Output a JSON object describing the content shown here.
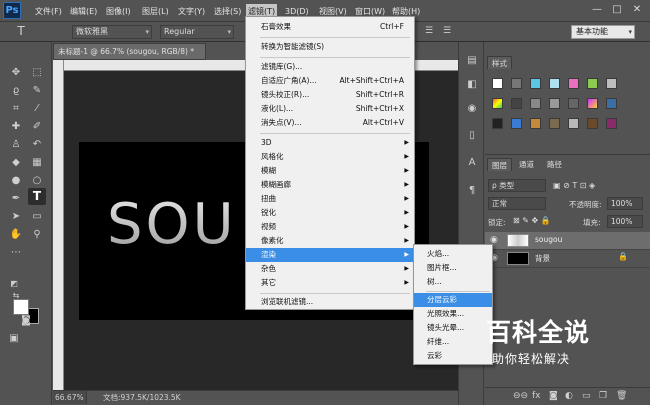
{
  "app": {
    "logo": "Ps"
  },
  "menubar": [
    {
      "label": "文件(F)"
    },
    {
      "label": "编辑(E)"
    },
    {
      "label": "图像(I)"
    },
    {
      "label": "图层(L)"
    },
    {
      "label": "文字(Y)"
    },
    {
      "label": "选择(S)"
    },
    {
      "label": "滤镜(T)"
    },
    {
      "label": "3D(D)"
    },
    {
      "label": "视图(V)"
    },
    {
      "label": "窗口(W)"
    },
    {
      "label": "帮助(H)"
    }
  ],
  "window_controls": {
    "minimize": "—",
    "maximize": "□",
    "close": "✕"
  },
  "options": {
    "tool_glyph": "T",
    "font_family": "微软雅黑",
    "font_style": "Regular",
    "preset": "基本功能"
  },
  "document": {
    "tab_title": "未标题-1 @ 66.7% (sougou, RGB/8) *",
    "tab_close": "×",
    "canvas_text": "SOU",
    "zoom": "66.67%",
    "info": "文档:937.5K/1023.5K"
  },
  "filter_menu": {
    "last_filter": {
      "label": "石膏效果",
      "shortcut": "Ctrl+F"
    },
    "convert_smart": "转换为智能滤镜(S)",
    "gallery": {
      "label": "滤镜库(G)...",
      "shortcut": ""
    },
    "adaptive": {
      "label": "自适应广角(A)...",
      "shortcut": "Alt+Shift+Ctrl+A"
    },
    "lens": {
      "label": "镜头校正(R)...",
      "shortcut": "Shift+Ctrl+R"
    },
    "liquify": {
      "label": "液化(L)...",
      "shortcut": "Shift+Ctrl+X"
    },
    "vanishing": {
      "label": "消失点(V)...",
      "shortcut": "Alt+Ctrl+V"
    },
    "categories": [
      "3D",
      "风格化",
      "模糊",
      "模糊画廊",
      "扭曲",
      "锐化",
      "视频",
      "像素化",
      "渲染",
      "杂色",
      "其它"
    ],
    "browse": "浏览联机滤镜...",
    "arrow": "▶"
  },
  "render_menu": {
    "items": [
      "火焰...",
      "图片框...",
      "树...",
      "分层云彩",
      "光照效果...",
      "镜头光晕...",
      "纤维...",
      "云彩"
    ]
  },
  "styles_panel": {
    "tab": "样式"
  },
  "layers_panel": {
    "tabs": [
      "图层",
      "通道",
      "路径"
    ],
    "filter_kind": "ρ 类型",
    "blend_mode": "正常",
    "opacity_label": "不透明度:",
    "opacity": "100%",
    "lock_label": "锁定:",
    "fill_label": "填充:",
    "fill": "100%",
    "layers": [
      {
        "name": "sougou",
        "selected": true
      },
      {
        "name": "背景",
        "selected": false
      }
    ]
  },
  "watermark": {
    "title": "百科全说",
    "subtitle": "助你轻松解决"
  },
  "colors": {
    "accent": "#3a8ee6",
    "foreground": "#ffffff",
    "background": "#000000"
  }
}
